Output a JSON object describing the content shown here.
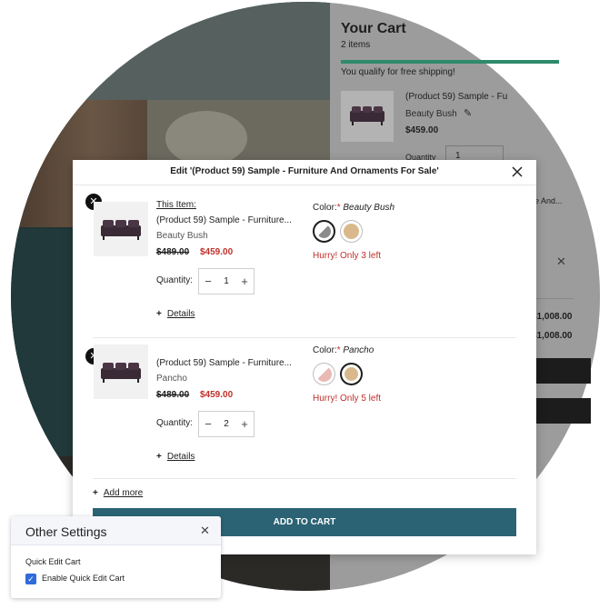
{
  "cart": {
    "title": "Your Cart",
    "count": "2 items",
    "shipping_text": "You qualify for free shipping!",
    "product_name": "(Product 59) Sample - Fu",
    "product_variant": "Beauty Bush",
    "product_price": "$459.00",
    "qty_label": "Quantity",
    "qty_value": "1",
    "fragment_name": "re And...",
    "subtotal": "$1,008.00",
    "total": "$1,008.00"
  },
  "modal": {
    "title": "Edit '(Product 59) Sample - Furniture And Ornaments For Sale'",
    "items": [
      {
        "label": "This Item:",
        "name": "(Product 59) Sample - Furniture...",
        "variant": "Beauty Bush",
        "old_price": "$489.00",
        "new_price": "$459.00",
        "qty_label": "Quantity:",
        "qty": "1",
        "details": "Details",
        "color_label": "Color:",
        "color_star": "*",
        "color_value": "Beauty Bush",
        "stock": "Hurry! Only 3 left",
        "swatches": [
          {
            "name": "beauty-bush",
            "color": "#8c8c8c",
            "selected": true
          },
          {
            "name": "pancho",
            "color": "#d9b98b",
            "selected": false
          }
        ]
      },
      {
        "label": "",
        "name": "(Product 59) Sample - Furniture...",
        "variant": "Pancho",
        "old_price": "$489.00",
        "new_price": "$459.00",
        "qty_label": "Quantity:",
        "qty": "2",
        "details": "Details",
        "color_label": "Color:",
        "color_star": "*",
        "color_value": "Pancho",
        "stock": "Hurry! Only 5 left",
        "swatches": [
          {
            "name": "beauty-bush",
            "color": "#e9b9b5",
            "selected": false
          },
          {
            "name": "pancho",
            "color": "#d9b98b",
            "selected": true
          }
        ]
      }
    ],
    "add_more": "Add more",
    "add_to_cart": "ADD TO CART"
  },
  "settings": {
    "title": "Other Settings",
    "section": "Quick Edit Cart",
    "checkbox_label": "Enable Quick Edit Cart",
    "checked": true
  },
  "colors": {
    "accent": "#2b6374",
    "price_red": "#c0302a",
    "checkbox_blue": "#2f6bd9"
  }
}
